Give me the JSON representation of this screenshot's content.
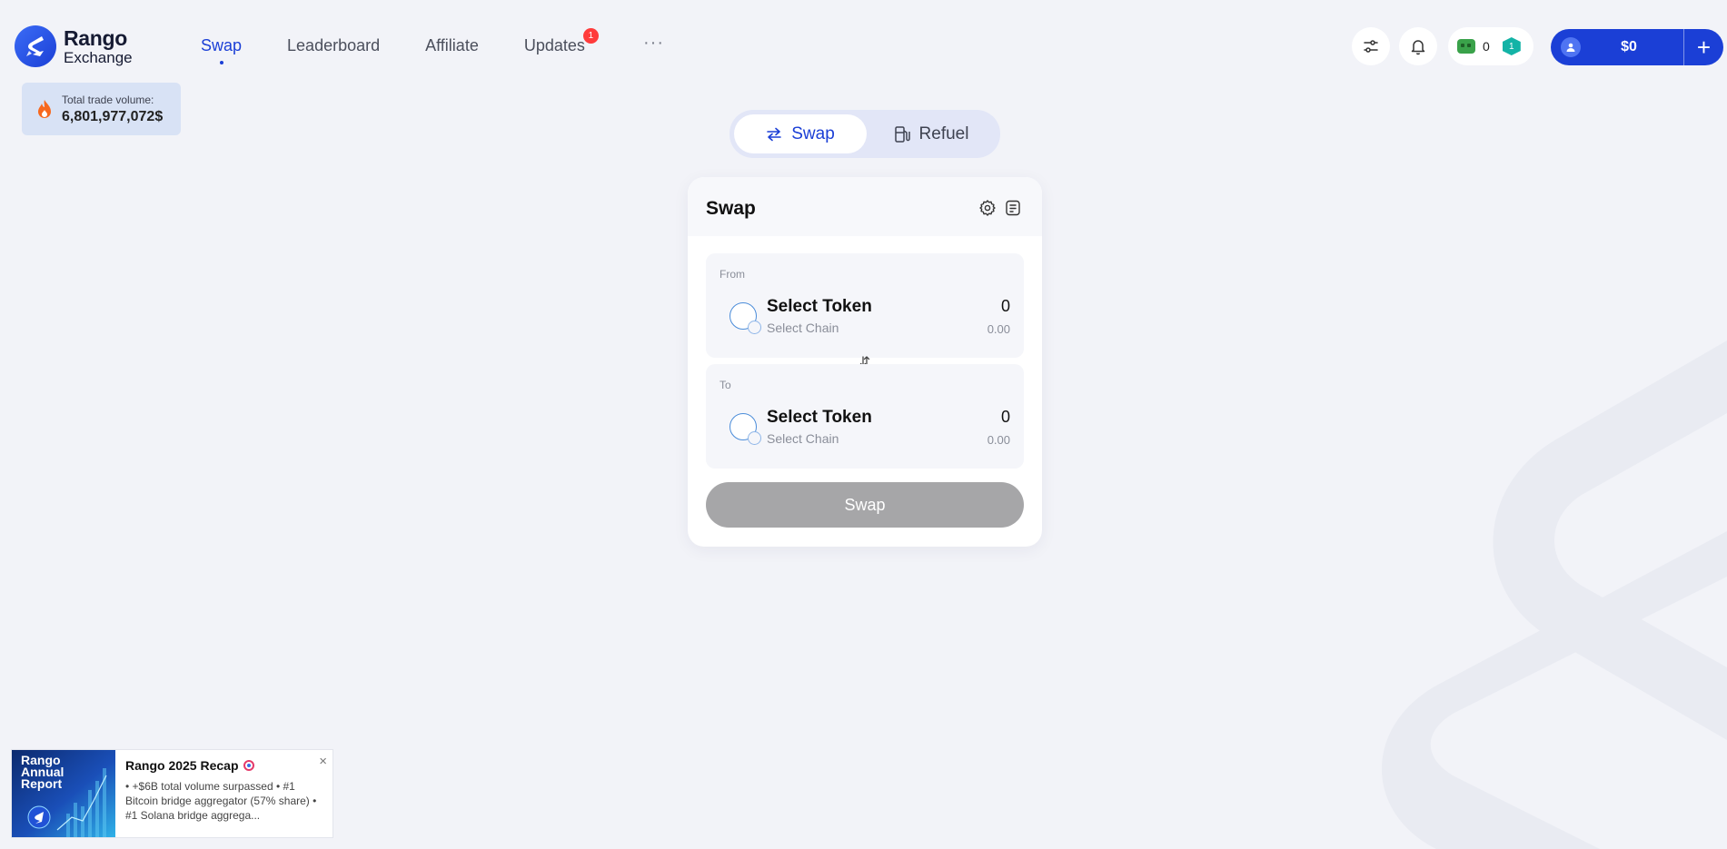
{
  "brand": {
    "name": "Rango",
    "sub": "Exchange"
  },
  "nav": {
    "items": [
      {
        "label": "Swap",
        "active": true
      },
      {
        "label": "Leaderboard"
      },
      {
        "label": "Affiliate"
      },
      {
        "label": "Updates",
        "badge": "1"
      }
    ],
    "more": "···"
  },
  "header": {
    "score_count": "0",
    "level": "1",
    "wallet_balance": "$0"
  },
  "volume": {
    "label": "Total trade volume:",
    "value": "6,801,977,072$"
  },
  "modes": {
    "swap": "Swap",
    "refuel": "Refuel"
  },
  "card": {
    "title": "Swap",
    "from": {
      "label": "From",
      "token": "Select Token",
      "chain": "Select Chain",
      "amount": "0",
      "usd": "0.00"
    },
    "to": {
      "label": "To",
      "token": "Select Token",
      "chain": "Select Chain",
      "amount": "0",
      "usd": "0.00"
    },
    "button": "Swap"
  },
  "recap": {
    "image_text": "Rango Annual Report",
    "title": "Rango 2025 Recap",
    "text": "• +$6B total volume surpassed • #1 Bitcoin bridge aggregator (57% share) • #1 Solana bridge aggrega...",
    "close": "×"
  },
  "colors": {
    "accent": "#1b3fd6",
    "background": "#f2f3f8",
    "disabled": "#a6a6a8",
    "badge": "#ff3b3b"
  },
  "icons": [
    "rango-logo-icon",
    "fire-icon",
    "sliders-icon",
    "bell-icon",
    "score-icon",
    "level-icon",
    "user-icon",
    "plus-icon",
    "swap-arrows-icon",
    "fuel-icon",
    "gear-icon",
    "history-icon",
    "switch-arrows-icon",
    "target-icon",
    "close-icon"
  ]
}
